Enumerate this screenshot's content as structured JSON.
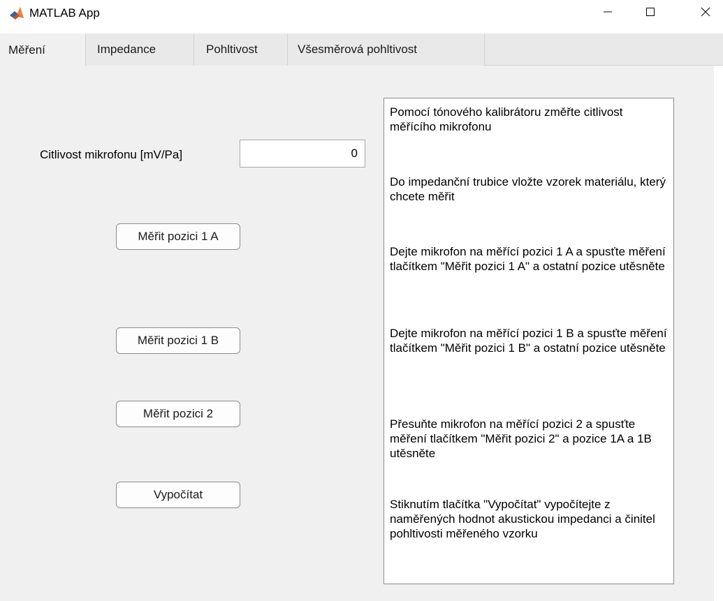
{
  "window": {
    "title": "MATLAB App",
    "icon": "matlab-logo-icon",
    "controls": [
      "minimize-icon",
      "maximize-icon",
      "close-icon"
    ]
  },
  "tabs": [
    {
      "label": "Měření",
      "active": true
    },
    {
      "label": "Impedance",
      "active": false
    },
    {
      "label": "Pohltivost",
      "active": false
    },
    {
      "label": "Všesměrová pohltivost",
      "active": false
    }
  ],
  "sensitivity": {
    "label": "Citlivost mikrofonu [mV/Pa]",
    "value": "0"
  },
  "buttons": {
    "measure_1a": "Měřit pozici 1 A",
    "measure_1b": "Měřit pozici 1 B",
    "measure_2": "Měřit pozici 2",
    "calculate": "Vypočítat"
  },
  "instructions": [
    "Pomocí tónového kalibrátoru změřte citlivost měřícího mikrofonu",
    "Do impedanční trubice vložte vzorek materiálu, který chcete měřit",
    "Dejte mikrofon na měřící pozici 1 A a spusťte měření tlačítkem \"Měřit pozici 1 A\" a ostatní pozice utěsněte",
    "Dejte mikrofon na měřící pozici 1 B a spusťte měření tlačítkem \"Měřit pozici 1 B\" a ostatní pozice utěsněte",
    "Přesuňte mikrofon na měřící pozici 2 a spusťte měření tlačítkem \"Měřit pozici 2\" a pozice 1A a 1B utěsněte",
    "Stiknutím tlačítka \"Vypočítat\" vypočítejte z naměřených hodnot akustickou impedanci a činitel pohltivosti měřeného vzorku"
  ],
  "colors": {
    "background": "#f0f0f0",
    "tab_inactive": "#e9e9e9",
    "border": "#8c8c8c"
  }
}
